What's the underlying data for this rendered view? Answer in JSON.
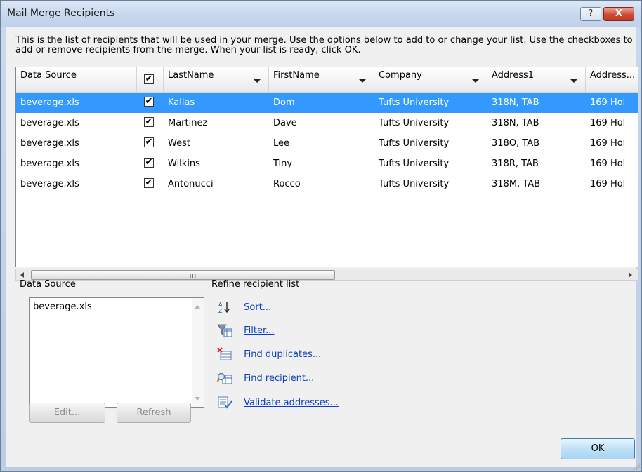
{
  "window": {
    "title": "Mail Merge Recipients",
    "help_label": "?",
    "close_label": "X"
  },
  "intro_text": "This is the list of recipients that will be used in your merge.  Use the options below to add to or change your list.  Use the checkboxes to add or remove recipients from the merge.  When your list is ready, click OK.",
  "grid": {
    "columns": [
      "Data Source",
      "",
      "LastName",
      "FirstName",
      "Company",
      "Address1",
      "Address..."
    ],
    "check_glyph": "✔",
    "rows": [
      {
        "source": "beverage.xls",
        "checked": "✔",
        "last": "Kallas",
        "first": "Dom",
        "company": "Tufts University",
        "address1": "318N, TAB",
        "address2": "169 Hol",
        "selected": true
      },
      {
        "source": "beverage.xls",
        "checked": "✔",
        "last": "Martinez",
        "first": "Dave",
        "company": "Tufts University",
        "address1": "318N, TAB",
        "address2": "169 Hol",
        "selected": false
      },
      {
        "source": "beverage.xls",
        "checked": "✔",
        "last": "West",
        "first": "Lee",
        "company": "Tufts University",
        "address1": "318O, TAB",
        "address2": "169 Hol",
        "selected": false
      },
      {
        "source": "beverage.xls",
        "checked": "✔",
        "last": "Wilkins",
        "first": "Tiny",
        "company": "Tufts University",
        "address1": "318R, TAB",
        "address2": "169 Hol",
        "selected": false
      },
      {
        "source": "beverage.xls",
        "checked": "✔",
        "last": "Antonucci",
        "first": "Rocco",
        "company": "Tufts University",
        "address1": "318M, TAB",
        "address2": "169 Hol",
        "selected": false
      }
    ],
    "scroll_grip": "III"
  },
  "data_source": {
    "label": "Data Source",
    "items": [
      "beverage.xls"
    ],
    "edit_label": "Edit...",
    "refresh_label": "Refresh"
  },
  "refine": {
    "label": "Refine recipient list",
    "items": [
      {
        "label": "Sort...",
        "icon": "sort-az-icon"
      },
      {
        "label": "Filter...",
        "icon": "filter-icon"
      },
      {
        "label": "Find duplicates...",
        "icon": "find-duplicates-icon"
      },
      {
        "label": "Find recipient...",
        "icon": "find-recipient-icon"
      },
      {
        "label": "Validate addresses...",
        "icon": "validate-addresses-icon"
      }
    ]
  },
  "ok_label": "OK"
}
